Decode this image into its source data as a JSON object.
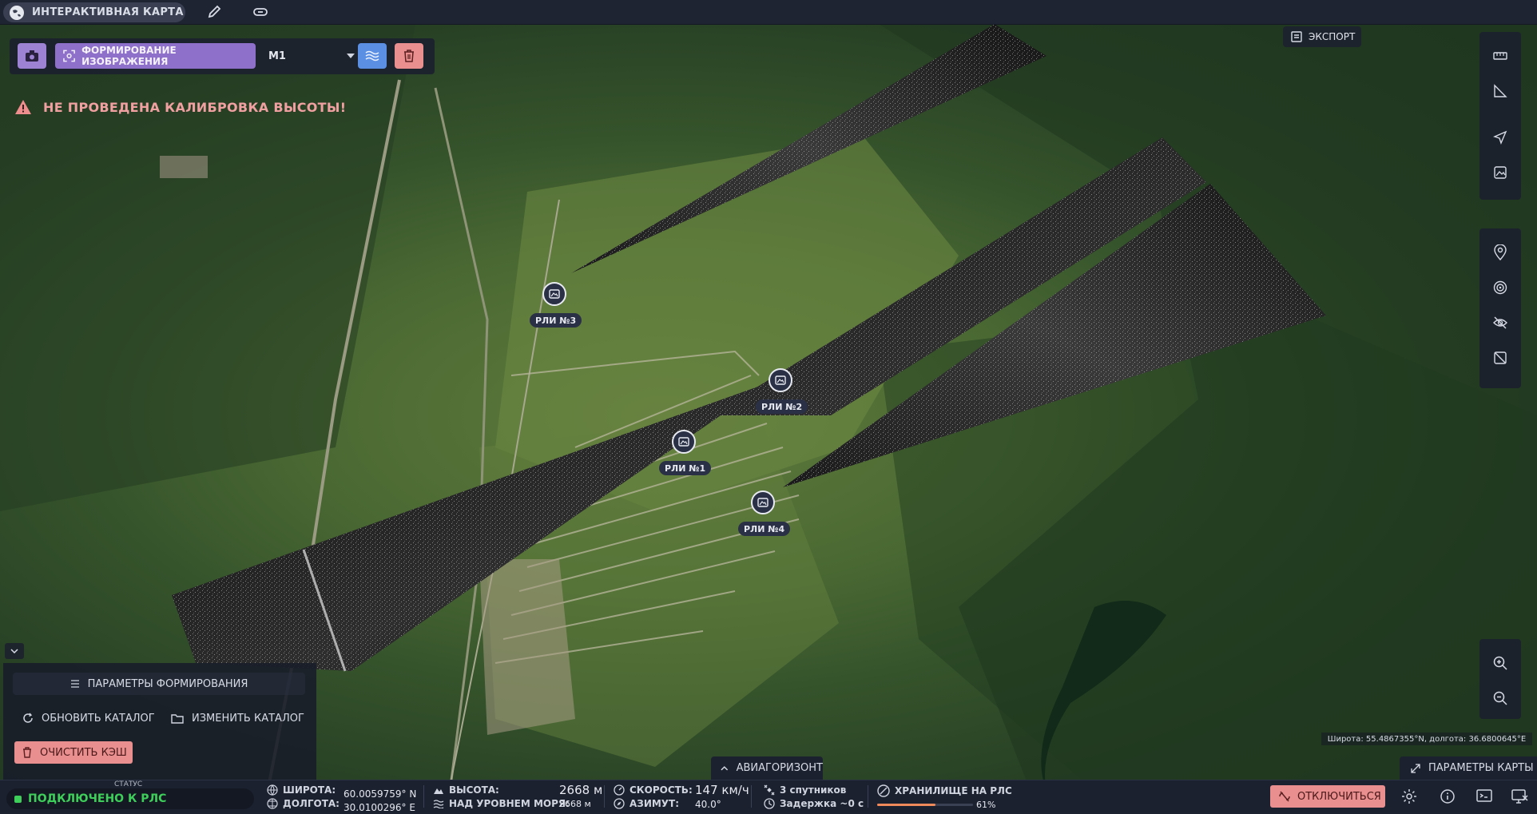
{
  "app": {
    "tab_title": "ИНТЕРАКТИВНАЯ КАРТА"
  },
  "toolbar": {
    "form_image_label": "ФОРМИРОВАНИЕ ИЗОБРАЖЕНИЯ",
    "mode_value": "М1"
  },
  "warning": {
    "text": "НЕ ПРОВЕДЕНА КАЛИБРОВКА ВЫСОТЫ!"
  },
  "export": {
    "label": "ЭКСПОРТ"
  },
  "markers": [
    {
      "label": "РЛИ №1"
    },
    {
      "label": "РЛИ №2"
    },
    {
      "label": "РЛИ №3"
    },
    {
      "label": "РЛИ №4"
    }
  ],
  "left_panel": {
    "params_label": "ПАРАМЕТРЫ ФОРМИРОВАНИЯ",
    "refresh_label": "ОБНОВИТЬ КАТАЛОГ",
    "change_label": "ИЗМЕНИТЬ КАТАЛОГ",
    "clear_cache_label": "ОЧИСТИТЬ КЭШ"
  },
  "horizon": {
    "label": "АВИАГОРИЗОНТ"
  },
  "map_params": {
    "label": "ПАРАМЕТРЫ КАРТЫ"
  },
  "cursor_coords": {
    "text": "Широта: 55.4867355°N, долгота: 36.6800645°E"
  },
  "status": {
    "caption": "СТАТУС",
    "connection": "ПОДКЛЮЧЕНО К РЛС"
  },
  "telemetry": {
    "lat_label": "ШИРОТА:",
    "lat_value": "60.0059759° N",
    "lon_label": "ДОЛГОТА:",
    "lon_value": "30.0100296° E",
    "alt_label": "ВЫСОТА:",
    "alt_value": "2668 м",
    "msl_label": "НАД УРОВНЕМ МОРЯ:",
    "msl_value": "2668 м",
    "speed_label": "СКОРОСТЬ:",
    "speed_value": "147 км/ч",
    "azimuth_label": "АЗИМУТ:",
    "azimuth_value": "40.0°",
    "satellites": "3 спутников",
    "delay": "Задержка ~0 с",
    "storage_label": "ХРАНИЛИЩЕ НА РЛС",
    "storage_percent": "61%",
    "storage_fraction": 0.61
  },
  "disconnect": {
    "label": "ОТКЛЮЧИТЬСЯ"
  },
  "colors": {
    "accent_purple": "#8e6fc9",
    "accent_blue": "#3c6fd6",
    "danger_red": "#e98f8f",
    "warning_text": "#f0a0a0",
    "status_green": "#3ecf5a"
  }
}
